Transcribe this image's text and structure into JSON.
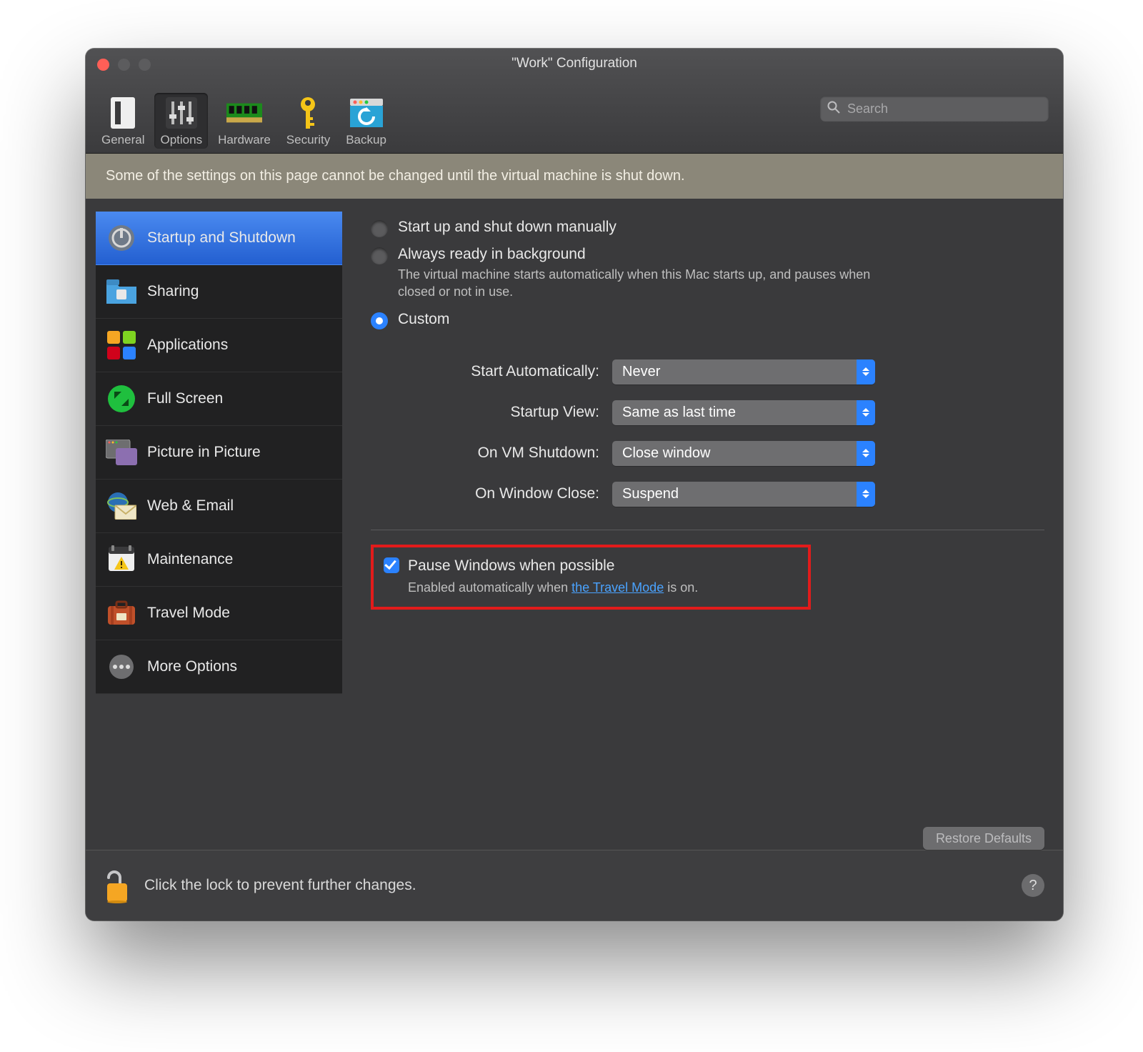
{
  "window": {
    "title": "\"Work\" Configuration"
  },
  "toolbar": {
    "items": [
      {
        "id": "general",
        "label": "General"
      },
      {
        "id": "options",
        "label": "Options"
      },
      {
        "id": "hardware",
        "label": "Hardware"
      },
      {
        "id": "security",
        "label": "Security"
      },
      {
        "id": "backup",
        "label": "Backup"
      }
    ],
    "active": "options",
    "search_placeholder": "Search"
  },
  "banner": "Some of the settings on this page cannot be changed until the virtual machine is shut down.",
  "sidebar": {
    "selected": 0,
    "items": [
      {
        "label": "Startup and Shutdown",
        "icon": "power-icon"
      },
      {
        "label": "Sharing",
        "icon": "folder-share-icon"
      },
      {
        "label": "Applications",
        "icon": "apps-icon"
      },
      {
        "label": "Full Screen",
        "icon": "fullscreen-icon"
      },
      {
        "label": "Picture in Picture",
        "icon": "pip-icon"
      },
      {
        "label": "Web & Email",
        "icon": "web-email-icon"
      },
      {
        "label": "Maintenance",
        "icon": "maintenance-icon"
      },
      {
        "label": "Travel Mode",
        "icon": "suitcase-icon"
      },
      {
        "label": "More Options",
        "icon": "more-icon"
      }
    ]
  },
  "radios": {
    "selected": "custom",
    "manual": {
      "label": "Start up and shut down manually"
    },
    "always": {
      "label": "Always ready in background",
      "desc": "The virtual machine starts automatically when this Mac starts up, and pauses when closed or not in use."
    },
    "custom": {
      "label": "Custom"
    }
  },
  "form": {
    "start_automatically": {
      "label": "Start Automatically:",
      "value": "Never"
    },
    "startup_view": {
      "label": "Startup View:",
      "value": "Same as last time"
    },
    "on_vm_shutdown": {
      "label": "On VM Shutdown:",
      "value": "Close window"
    },
    "on_window_close": {
      "label": "On Window Close:",
      "value": "Suspend"
    }
  },
  "pause": {
    "checked": true,
    "label": "Pause Windows when possible",
    "desc_pre": "Enabled automatically when ",
    "link": "the Travel Mode",
    "desc_post": " is on."
  },
  "restore_defaults": "Restore Defaults",
  "footer": {
    "text": "Click the lock to prevent further changes.",
    "help": "?"
  }
}
